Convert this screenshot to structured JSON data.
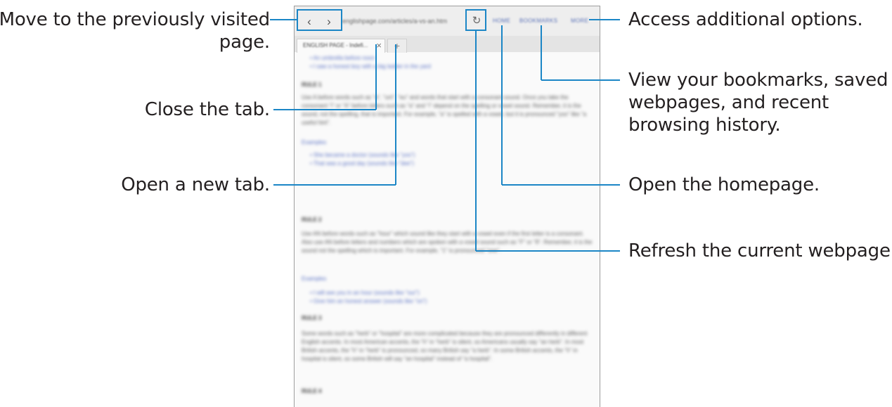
{
  "callouts": {
    "back_forward": [
      "Move to the previously visited",
      "page."
    ],
    "close_tab": [
      "Close the tab."
    ],
    "new_tab": [
      "Open a new tab."
    ],
    "more": [
      "Access additional options."
    ],
    "bookmarks": [
      "View your bookmarks, saved",
      "webpages, and recent",
      "browsing history."
    ],
    "home": [
      "Open the homepage."
    ],
    "refresh": [
      "Refresh the current webpage."
    ]
  },
  "browser": {
    "back_icon": "chevron-left-icon",
    "back_glyph": "‹",
    "forward_icon": "chevron-right-icon",
    "forward_glyph": "›",
    "url": "englishpage.com/articles/a-vs-an.htm",
    "refresh_icon": "refresh-icon",
    "refresh_glyph": "↻",
    "home_label": "HOME",
    "bookmarks_label": "BOOKMARKS",
    "more_label": "MORE",
    "tab_title": "ENGLISH PAGE - Indefi...",
    "tab_close_glyph": "×",
    "new_tab_glyph": "+"
  },
  "page": {
    "bullets_top": [
      "• An umbrella before noon",
      "• I saw a honest boy with a big ladder in the yard"
    ],
    "rule1_heading": "RULE 1",
    "rule1_text": "Use A before words such as \"a\", \"uni\", \"eu\" and words that start with a consonant sound. Once you take the consonant \"i\" or \"A\" before letters such as \"a\" and \"i\" depend on the spelling or vowel sound. Remember, it is the sound, not the spelling, that is important. For example, \"a\" is spelled with a vowel, but it is pronounced \"yoo\" like \"a useful hint\".",
    "examples1_label": "Examples",
    "examples1": [
      "• She became a doctor (sounds like \"yoo\")",
      "• That was a good day (sounds like \"dee\")"
    ],
    "rule2_heading": "RULE 2",
    "rule2_text": "Use AN before words such as \"hour\" which sound like they start with a vowel even if the first letter is a consonant. Also use AN before letters and numbers which are spoken with a vowel sound such as \"F\" or \"8\". Remember, it is the sound not the spelling which is important. For example, \"1\" is pronounced \"one\".",
    "examples2_label": "Examples",
    "examples2": [
      "• I will see you in an hour (sounds like \"our\")",
      "• Give him an honest answer (sounds like \"on\")"
    ],
    "rule3_heading": "RULE 3",
    "rule3_text": "Some words such as \"herb\" or \"hospital\" are more complicated because they are pronounced differently in different English accents. In most American accents, the \"h\" in \"herb\" is silent, so Americans usually say \"an herb\". In most British accents, the \"h\" in \"herb\" is pronounced, so many British say \"a herb\". In some British accents, the \"h\" in hospital is silent, so some British will say \"an hospital\" instead of \"a hospital\".",
    "rule4_heading": "RULE 4"
  }
}
